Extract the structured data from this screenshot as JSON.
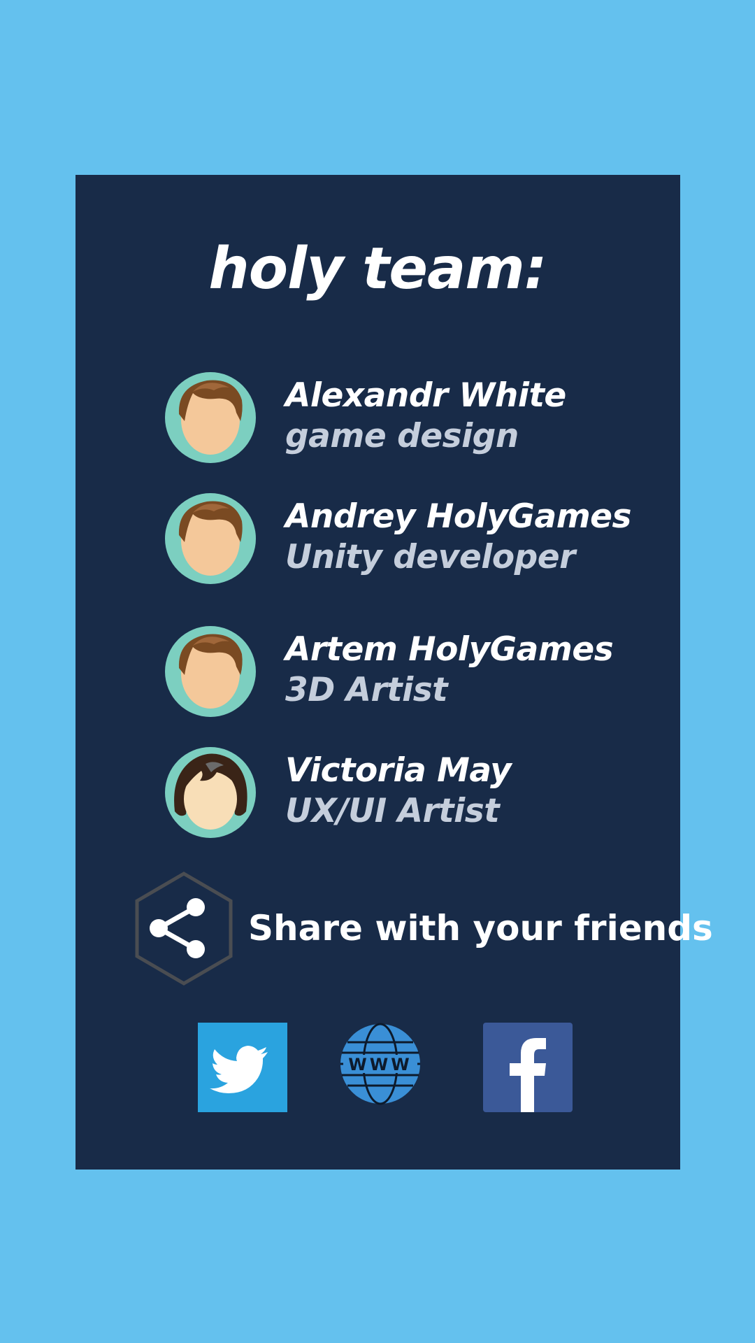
{
  "title": "holy team:",
  "members": [
    {
      "name": "Alexandr White",
      "role": "game design",
      "avatar": "male-avatar-icon"
    },
    {
      "name": "Andrey HolyGames",
      "role": "Unity developer",
      "avatar": "male-avatar-icon"
    },
    {
      "name": "Artem HolyGames",
      "role": "3D Artist",
      "avatar": "male-avatar-icon"
    },
    {
      "name": "Victoria May",
      "role": "UX/UI Artist",
      "avatar": "female-avatar-icon"
    }
  ],
  "share": {
    "label": "Share with your friends",
    "icon": "share-icon"
  },
  "social": {
    "twitter_icon": "twitter-icon",
    "website_icon": "www-globe-icon",
    "website_text": "WWW",
    "facebook_icon": "facebook-icon"
  },
  "colors": {
    "background": "#64c1ee",
    "panel": "#182b48",
    "role_text": "#c5cedc",
    "avatar_ring": "#7ccfc0",
    "twitter": "#2aa3df",
    "website": "#3a8fd6",
    "facebook": "#3b5998"
  }
}
